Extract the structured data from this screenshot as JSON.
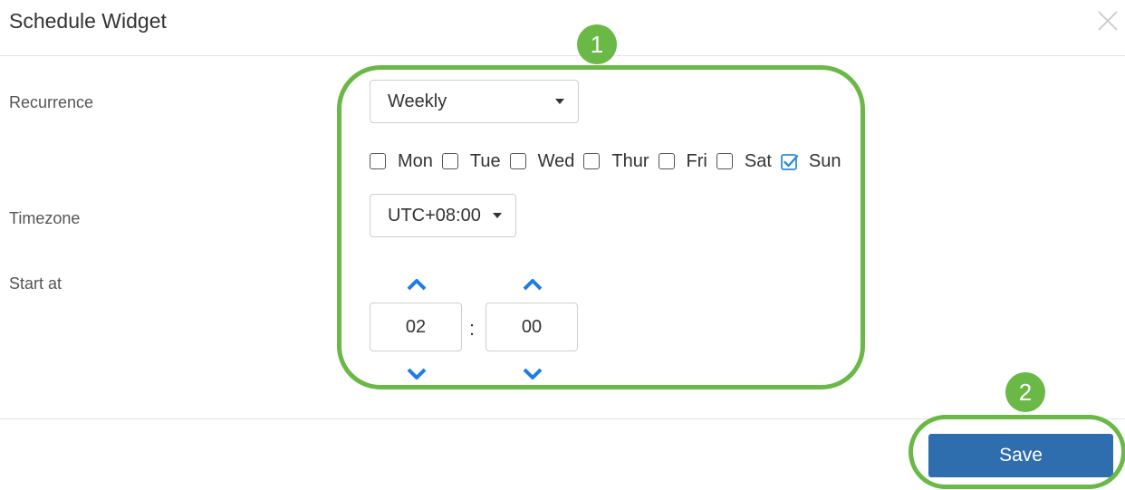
{
  "header": {
    "title": "Schedule Widget"
  },
  "form": {
    "recurrence": {
      "label": "Recurrence",
      "selected": "Weekly",
      "days": [
        {
          "label": "Mon",
          "checked": false
        },
        {
          "label": "Tue",
          "checked": false
        },
        {
          "label": "Wed",
          "checked": false
        },
        {
          "label": "Thur",
          "checked": false
        },
        {
          "label": "Fri",
          "checked": false
        },
        {
          "label": "Sat",
          "checked": false
        },
        {
          "label": "Sun",
          "checked": true
        }
      ]
    },
    "timezone": {
      "label": "Timezone",
      "selected": "UTC+08:00"
    },
    "start_at": {
      "label": "Start at",
      "hour": "02",
      "separator": ":",
      "minute": "00"
    }
  },
  "annotations": {
    "badge1": "1",
    "badge2": "2"
  },
  "footer": {
    "save_label": "Save"
  },
  "colors": {
    "accent": "#6ab845",
    "primary_button": "#2e6eae",
    "chevron": "#1e7ce6",
    "checkbox_checked": "#2b8fd8"
  }
}
